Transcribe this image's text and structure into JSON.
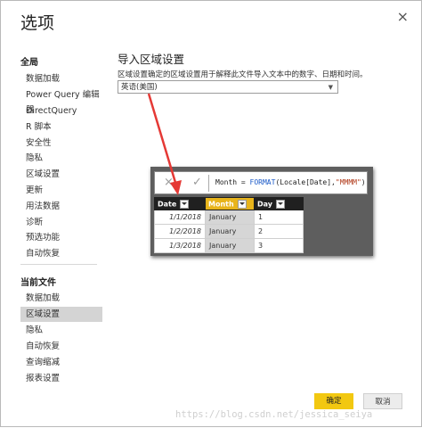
{
  "dialog": {
    "title": "选项",
    "close_glyph": "×"
  },
  "sidebar": {
    "global_header": "全局",
    "global_items": [
      {
        "label": "数据加载"
      },
      {
        "label": "Power Query 编辑器"
      },
      {
        "label": "DirectQuery"
      },
      {
        "label": "R 脚本"
      },
      {
        "label": "安全性"
      },
      {
        "label": "隐私"
      },
      {
        "label": "区域设置"
      },
      {
        "label": "更新"
      },
      {
        "label": "用法数据"
      },
      {
        "label": "诊断"
      },
      {
        "label": "预选功能"
      },
      {
        "label": "自动恢复"
      }
    ],
    "file_header": "当前文件",
    "file_items": [
      {
        "label": "数据加载"
      },
      {
        "label": "区域设置",
        "selected": true
      },
      {
        "label": "隐私"
      },
      {
        "label": "自动恢复"
      },
      {
        "label": "查询缩减"
      },
      {
        "label": "报表设置"
      }
    ]
  },
  "main": {
    "heading": "导入区域设置",
    "description": "区域设置确定的区域设置用于解释此文件导入文本中的数字、日期和时间。",
    "locale_select": {
      "value": "英语(美国)",
      "icon": "chevron-down-icon"
    }
  },
  "embedded": {
    "cancel_icon": "×",
    "commit_icon": "✓",
    "formula": {
      "lhs": "Month = ",
      "fn": "FORMAT",
      "mid": "(Locale[Date],",
      "str": "\"MMMM\"",
      "end": ")"
    },
    "columns": [
      "Date",
      "Month",
      "Day"
    ],
    "rows": [
      {
        "date": "1/1/2018",
        "month": "January",
        "day": "1"
      },
      {
        "date": "1/2/2018",
        "month": "January",
        "day": "2"
      },
      {
        "date": "1/3/2018",
        "month": "January",
        "day": "3"
      }
    ],
    "highlight_color": "#e8b41b",
    "arrow_color": "#e53935"
  },
  "footer": {
    "ok_label": "确定",
    "cancel_label": "取消"
  },
  "watermark": "https://blog.csdn.net/jessica_seiya",
  "colors": {
    "accent": "#f2c811"
  }
}
